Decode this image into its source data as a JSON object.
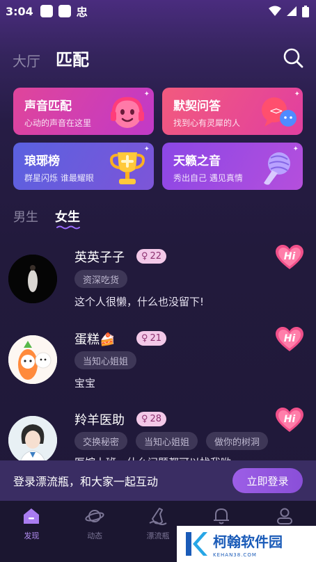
{
  "status_bar": {
    "time": "3:04",
    "carrier_glyph": "忠"
  },
  "top_tabs": {
    "hall": "大厅",
    "match": "匹配"
  },
  "features": [
    {
      "title": "声音匹配",
      "subtitle": "心动的声音在这里",
      "icon": "headphone-face-icon"
    },
    {
      "title": "默契问答",
      "subtitle": "找到心有灵犀的人",
      "icon": "chat-bubbles-icon"
    },
    {
      "title": "琅琊榜",
      "subtitle": "群星闪烁 谁最耀眼",
      "icon": "trophy-icon"
    },
    {
      "title": "天籁之音",
      "subtitle": "秀出自己 遇见真情",
      "icon": "microphone-icon"
    }
  ],
  "gender_tabs": {
    "male": "男生",
    "female": "女生"
  },
  "users": [
    {
      "name": "英英子子",
      "age": "22",
      "tags": [
        "资深吃货"
      ],
      "bio": "这个人很懒，什么也没留下!"
    },
    {
      "name": "蛋糕🍰",
      "age": "21",
      "tags": [
        "当知心姐姐"
      ],
      "bio": "宝宝"
    },
    {
      "name": "羚羊医助",
      "age": "28",
      "tags": [
        "交换秘密",
        "当知心姐姐",
        "做你的树洞"
      ],
      "bio": "医馆上班，什么问题都可以找我哟"
    }
  ],
  "hi_label": "Hi",
  "login_bar": {
    "text": "登录漂流瓶，和大家一起互动",
    "button": "立即登录"
  },
  "bottom_nav": [
    {
      "label": "发现",
      "icon": "discover-home-icon"
    },
    {
      "label": "动态",
      "icon": "planet-icon"
    },
    {
      "label": "漂流瓶",
      "icon": "bottle-icon"
    },
    {
      "label": "",
      "icon": "bell-icon"
    },
    {
      "label": "",
      "icon": "profile-icon"
    }
  ],
  "watermark": {
    "name": "柯翰软件园",
    "url": "KEHAN38.COM"
  },
  "colors": {
    "accent": "#9c5ee6",
    "age_badge": "#f3c9e8",
    "hi_heart": "#f0508a"
  }
}
